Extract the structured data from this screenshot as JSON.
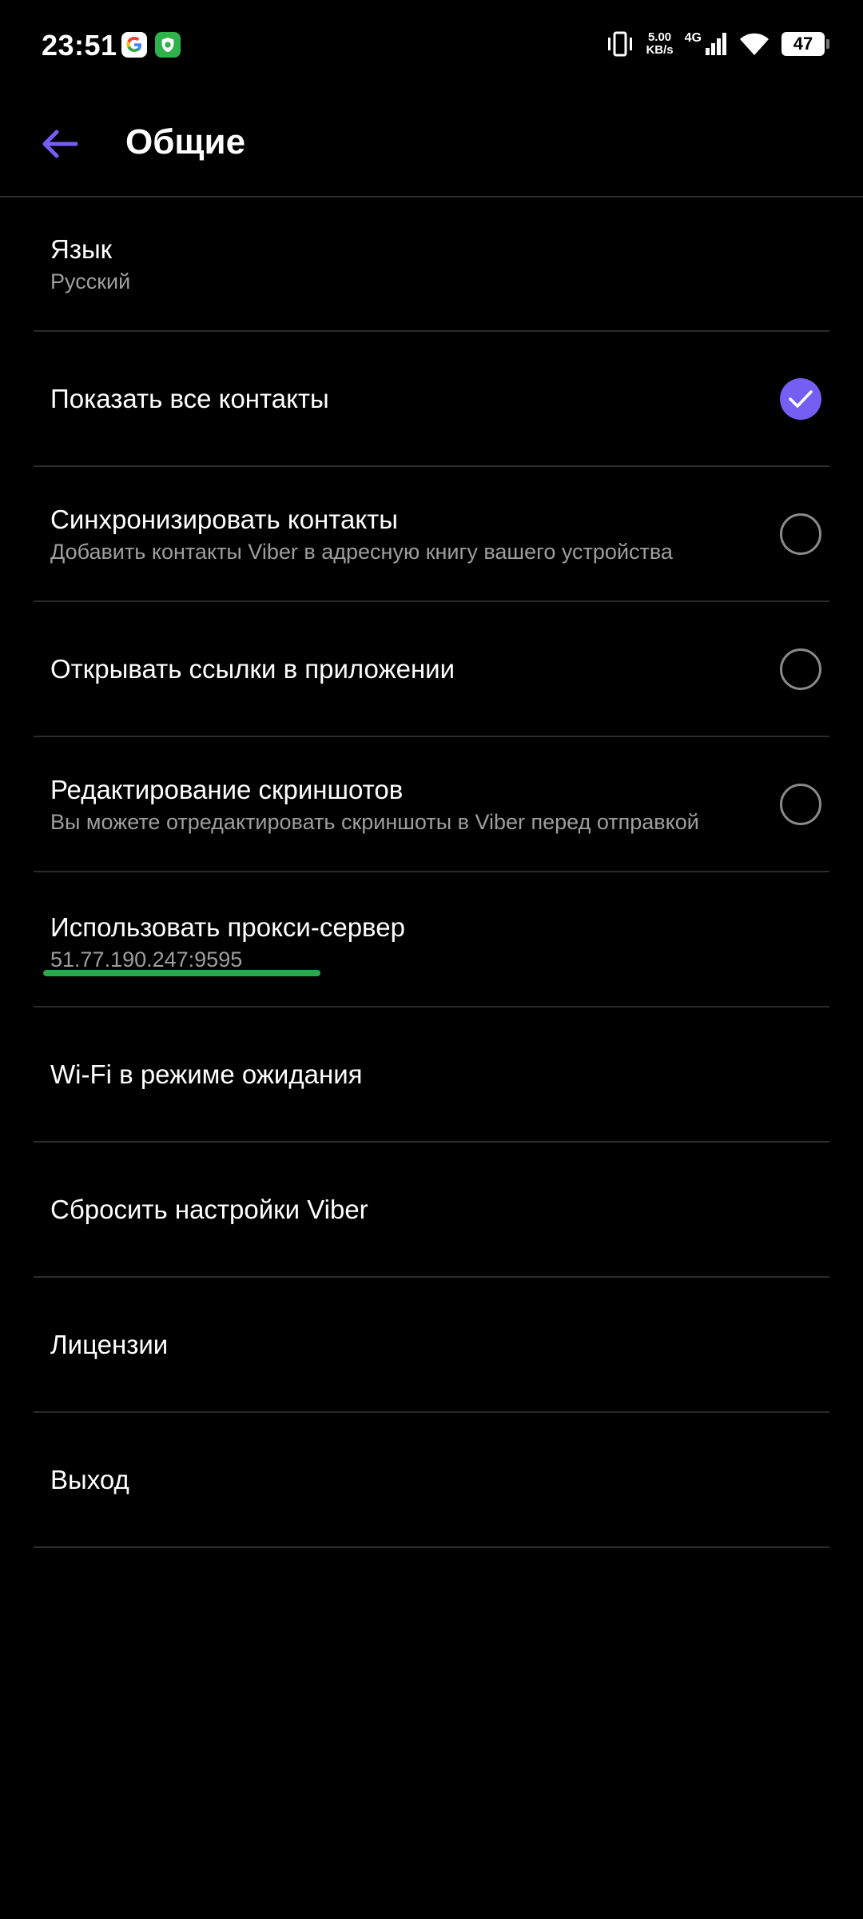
{
  "status_bar": {
    "time": "23:51",
    "speed_value": "5.00",
    "speed_unit": "KB/s",
    "network": "4G",
    "battery": "47",
    "icons": [
      "google-icon",
      "shield-app-icon",
      "vibrate-icon",
      "signal-icon",
      "wifi-icon",
      "battery-icon"
    ]
  },
  "header": {
    "title": "Общие",
    "back_icon": "arrow-left-icon",
    "accent_color": "#7360f2"
  },
  "settings": [
    {
      "title": "Язык",
      "subtitle": "Русский"
    },
    {
      "title": "Показать все контакты",
      "checked": true
    },
    {
      "title": "Синхронизировать контакты",
      "subtitle": "Добавить контакты Viber в адресную книгу вашего устройства",
      "checked": false
    },
    {
      "title": "Открывать ссылки в приложении",
      "checked": false
    },
    {
      "title": "Редактирование скриншотов",
      "subtitle": "Вы можете отредактировать скриншоты в Viber перед отправкой",
      "checked": false
    },
    {
      "title": "Использовать прокси-сервер",
      "subtitle": "51.77.190.247:9595",
      "progress_fraction": 0.6,
      "progress_color": "#2ea64c"
    },
    {
      "title": "Wi-Fi в режиме ожидания"
    },
    {
      "title": "Сбросить настройки Viber"
    },
    {
      "title": "Лицензии"
    },
    {
      "title": "Выход"
    }
  ]
}
